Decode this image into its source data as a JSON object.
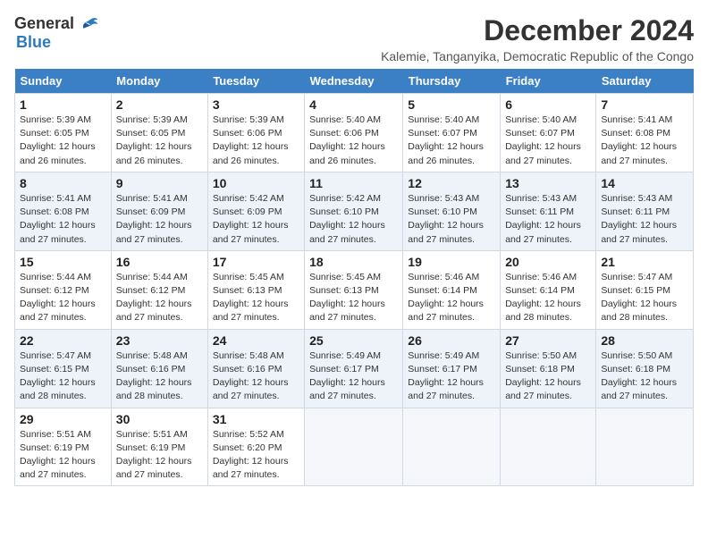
{
  "header": {
    "logo_general": "General",
    "logo_blue": "Blue",
    "month_title": "December 2024",
    "location": "Kalemie, Tanganyika, Democratic Republic of the Congo"
  },
  "calendar": {
    "days_of_week": [
      "Sunday",
      "Monday",
      "Tuesday",
      "Wednesday",
      "Thursday",
      "Friday",
      "Saturday"
    ],
    "weeks": [
      [
        {
          "day": "1",
          "sunrise": "5:39 AM",
          "sunset": "6:05 PM",
          "daylight": "12 hours and 26 minutes."
        },
        {
          "day": "2",
          "sunrise": "5:39 AM",
          "sunset": "6:05 PM",
          "daylight": "12 hours and 26 minutes."
        },
        {
          "day": "3",
          "sunrise": "5:39 AM",
          "sunset": "6:06 PM",
          "daylight": "12 hours and 26 minutes."
        },
        {
          "day": "4",
          "sunrise": "5:40 AM",
          "sunset": "6:06 PM",
          "daylight": "12 hours and 26 minutes."
        },
        {
          "day": "5",
          "sunrise": "5:40 AM",
          "sunset": "6:07 PM",
          "daylight": "12 hours and 26 minutes."
        },
        {
          "day": "6",
          "sunrise": "5:40 AM",
          "sunset": "6:07 PM",
          "daylight": "12 hours and 27 minutes."
        },
        {
          "day": "7",
          "sunrise": "5:41 AM",
          "sunset": "6:08 PM",
          "daylight": "12 hours and 27 minutes."
        }
      ],
      [
        {
          "day": "8",
          "sunrise": "5:41 AM",
          "sunset": "6:08 PM",
          "daylight": "12 hours and 27 minutes."
        },
        {
          "day": "9",
          "sunrise": "5:41 AM",
          "sunset": "6:09 PM",
          "daylight": "12 hours and 27 minutes."
        },
        {
          "day": "10",
          "sunrise": "5:42 AM",
          "sunset": "6:09 PM",
          "daylight": "12 hours and 27 minutes."
        },
        {
          "day": "11",
          "sunrise": "5:42 AM",
          "sunset": "6:10 PM",
          "daylight": "12 hours and 27 minutes."
        },
        {
          "day": "12",
          "sunrise": "5:43 AM",
          "sunset": "6:10 PM",
          "daylight": "12 hours and 27 minutes."
        },
        {
          "day": "13",
          "sunrise": "5:43 AM",
          "sunset": "6:11 PM",
          "daylight": "12 hours and 27 minutes."
        },
        {
          "day": "14",
          "sunrise": "5:43 AM",
          "sunset": "6:11 PM",
          "daylight": "12 hours and 27 minutes."
        }
      ],
      [
        {
          "day": "15",
          "sunrise": "5:44 AM",
          "sunset": "6:12 PM",
          "daylight": "12 hours and 27 minutes."
        },
        {
          "day": "16",
          "sunrise": "5:44 AM",
          "sunset": "6:12 PM",
          "daylight": "12 hours and 27 minutes."
        },
        {
          "day": "17",
          "sunrise": "5:45 AM",
          "sunset": "6:13 PM",
          "daylight": "12 hours and 27 minutes."
        },
        {
          "day": "18",
          "sunrise": "5:45 AM",
          "sunset": "6:13 PM",
          "daylight": "12 hours and 27 minutes."
        },
        {
          "day": "19",
          "sunrise": "5:46 AM",
          "sunset": "6:14 PM",
          "daylight": "12 hours and 27 minutes."
        },
        {
          "day": "20",
          "sunrise": "5:46 AM",
          "sunset": "6:14 PM",
          "daylight": "12 hours and 28 minutes."
        },
        {
          "day": "21",
          "sunrise": "5:47 AM",
          "sunset": "6:15 PM",
          "daylight": "12 hours and 28 minutes."
        }
      ],
      [
        {
          "day": "22",
          "sunrise": "5:47 AM",
          "sunset": "6:15 PM",
          "daylight": "12 hours and 28 minutes."
        },
        {
          "day": "23",
          "sunrise": "5:48 AM",
          "sunset": "6:16 PM",
          "daylight": "12 hours and 28 minutes."
        },
        {
          "day": "24",
          "sunrise": "5:48 AM",
          "sunset": "6:16 PM",
          "daylight": "12 hours and 27 minutes."
        },
        {
          "day": "25",
          "sunrise": "5:49 AM",
          "sunset": "6:17 PM",
          "daylight": "12 hours and 27 minutes."
        },
        {
          "day": "26",
          "sunrise": "5:49 AM",
          "sunset": "6:17 PM",
          "daylight": "12 hours and 27 minutes."
        },
        {
          "day": "27",
          "sunrise": "5:50 AM",
          "sunset": "6:18 PM",
          "daylight": "12 hours and 27 minutes."
        },
        {
          "day": "28",
          "sunrise": "5:50 AM",
          "sunset": "6:18 PM",
          "daylight": "12 hours and 27 minutes."
        }
      ],
      [
        {
          "day": "29",
          "sunrise": "5:51 AM",
          "sunset": "6:19 PM",
          "daylight": "12 hours and 27 minutes."
        },
        {
          "day": "30",
          "sunrise": "5:51 AM",
          "sunset": "6:19 PM",
          "daylight": "12 hours and 27 minutes."
        },
        {
          "day": "31",
          "sunrise": "5:52 AM",
          "sunset": "6:20 PM",
          "daylight": "12 hours and 27 minutes."
        },
        null,
        null,
        null,
        null
      ]
    ]
  }
}
